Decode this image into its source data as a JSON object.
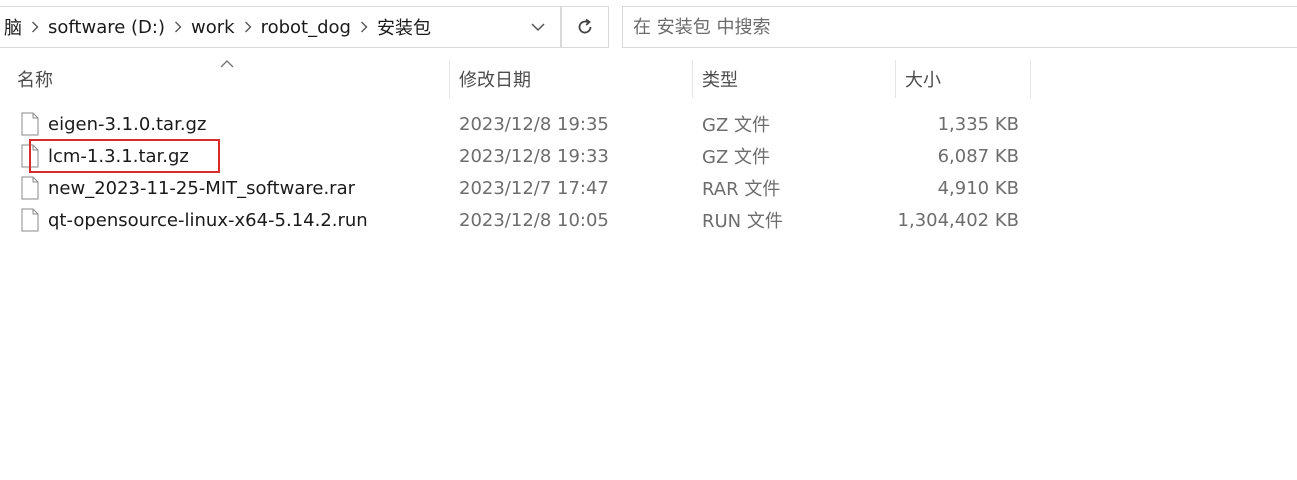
{
  "breadcrumb": {
    "items": [
      "脑",
      "software (D:)",
      "work",
      "robot_dog",
      "安装包"
    ]
  },
  "search": {
    "placeholder": "在 安装包 中搜索",
    "value": ""
  },
  "columns": {
    "name": "名称",
    "date": "修改日期",
    "type": "类型",
    "size": "大小"
  },
  "files": [
    {
      "name": "eigen-3.1.0.tar.gz",
      "date": "2023/12/8 19:35",
      "type": "GZ 文件",
      "size": "1,335 KB"
    },
    {
      "name": "lcm-1.3.1.tar.gz",
      "date": "2023/12/8 19:33",
      "type": "GZ 文件",
      "size": "6,087 KB"
    },
    {
      "name": "new_2023-11-25-MIT_software.rar",
      "date": "2023/12/7 17:47",
      "type": "RAR 文件",
      "size": "4,910 KB"
    },
    {
      "name": "qt-opensource-linux-x64-5.14.2.run",
      "date": "2023/12/8 10:05",
      "type": "RUN 文件",
      "size": "1,304,402 KB"
    }
  ],
  "icons": {
    "breadcrumb_separator": "chevron-right-icon",
    "address_dropdown": "chevron-down-icon",
    "refresh": "refresh-icon",
    "sort": "sort-ascending-icon",
    "file": "file-icon"
  },
  "colors": {
    "highlight": "#d92b2b"
  }
}
